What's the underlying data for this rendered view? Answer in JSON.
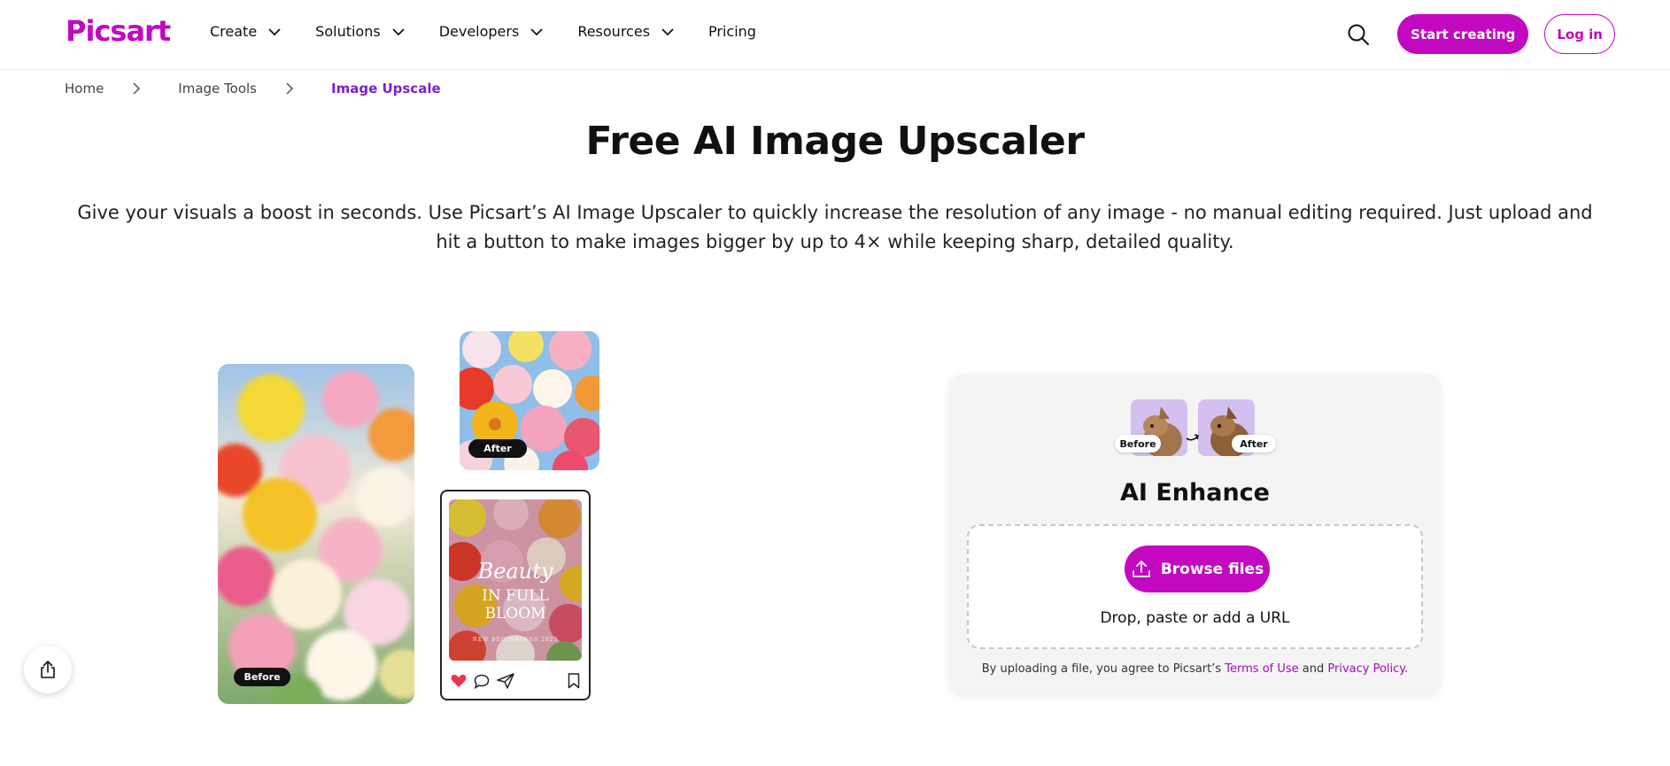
{
  "brand": {
    "logo": "Picsart",
    "accent": "#c209c1"
  },
  "nav": {
    "items": [
      {
        "label": "Create"
      },
      {
        "label": "Solutions"
      },
      {
        "label": "Developers"
      },
      {
        "label": "Resources"
      },
      {
        "label": "Pricing"
      }
    ],
    "start_label": "Start creating",
    "login_label": "Log in"
  },
  "breadcrumb": {
    "items": [
      "Home",
      "Image Tools",
      "Image Upscale"
    ]
  },
  "hero": {
    "title": "Free AI Image Upscaler",
    "subtitle_line1": "Give your visuals a boost in seconds. Use Picsart’s AI Image Upscaler to quickly increase the resolution of any image - no manual editing required. Just upload and",
    "subtitle_line2": "hit a button to make images bigger by up to 4× while keeping sharp, detailed quality."
  },
  "showcase": {
    "before_label": "Before",
    "after_label": "After",
    "post_line1": "Beauty",
    "post_line2": "IN FULL BLOOM",
    "post_line3": "NEW BEGINNINGS 2025"
  },
  "tool_card": {
    "before_label": "Before",
    "after_label": "After",
    "title": "AI Enhance",
    "browse_label": "Browse files",
    "drop_text": "Drop, paste or add a URL",
    "legal_prefix": "By uploading a file, you agree to Picsart’s ",
    "terms_label": "Terms of Use",
    "legal_and": " and ",
    "privacy_label": "Privacy Policy."
  }
}
